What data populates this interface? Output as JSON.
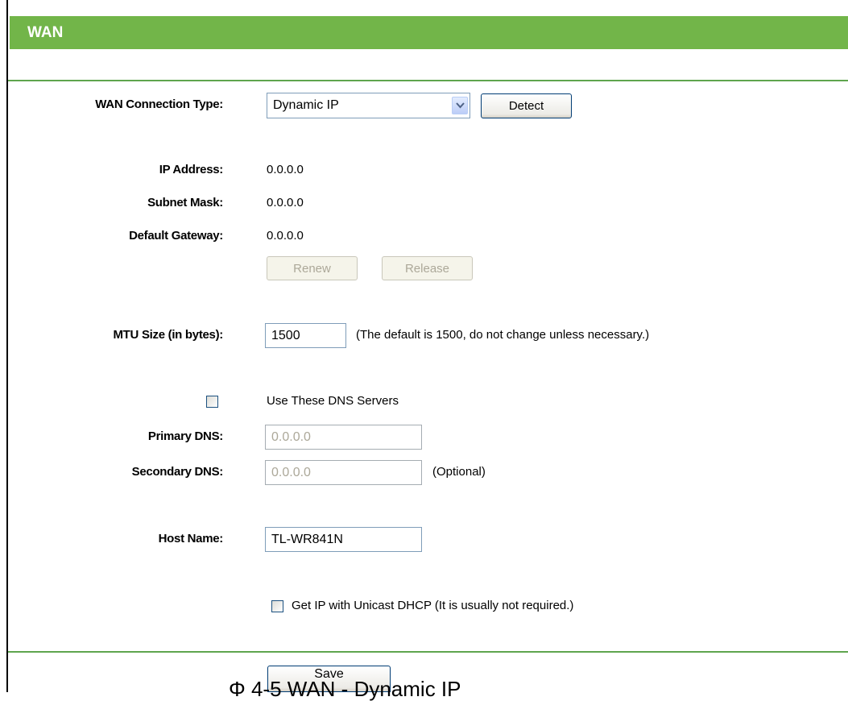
{
  "header": {
    "title": "WAN"
  },
  "connection": {
    "label": "WAN Connection Type:",
    "selected": "Dynamic IP",
    "detect_label": "Detect"
  },
  "status": {
    "ip_label": "IP Address:",
    "ip_value": "0.0.0.0",
    "mask_label": "Subnet Mask:",
    "mask_value": "0.0.0.0",
    "gateway_label": "Default Gateway:",
    "gateway_value": "0.0.0.0",
    "renew_label": "Renew",
    "release_label": "Release"
  },
  "mtu": {
    "label": "MTU Size (in bytes):",
    "value": "1500",
    "note": "(The default is 1500, do not change unless necessary.)"
  },
  "dns": {
    "use_label": "Use These DNS Servers",
    "use_checked": false,
    "primary_label": "Primary DNS:",
    "primary_value": "0.0.0.0",
    "secondary_label": "Secondary DNS:",
    "secondary_value": "0.0.0.0",
    "optional_note": "(Optional)"
  },
  "host": {
    "label": "Host Name:",
    "value": "TL-WR841N"
  },
  "unicast": {
    "label": "Get IP with Unicast DHCP (It is usually not required.)",
    "checked": false
  },
  "footer": {
    "save_label": "Save",
    "caption": "Φ      4-5 WAN - Dynamic IP"
  },
  "colors": {
    "header_green": "#72b549",
    "rule_green": "#5fa54e",
    "disabled_text": "#aca899"
  }
}
